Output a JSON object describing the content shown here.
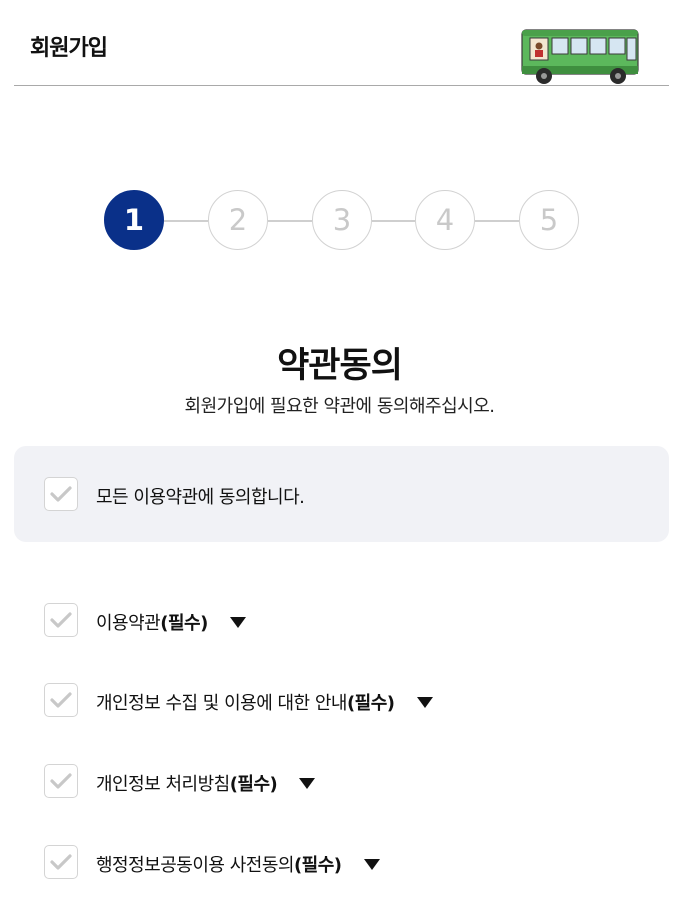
{
  "header": {
    "title": "회원가입"
  },
  "stepper": {
    "steps": [
      "1",
      "2",
      "3",
      "4",
      "5"
    ],
    "active": 1
  },
  "section": {
    "title": "약관동의",
    "subtitle": "회원가입에 필요한 약관에 동의해주십시오."
  },
  "agree_all": {
    "label": "모든 이용약관에 동의합니다.",
    "checked": false
  },
  "terms": [
    {
      "name": "이용약관",
      "required": "(필수)",
      "checked": false
    },
    {
      "name": "개인정보 수집 및 이용에 대한 안내",
      "required": "(필수)",
      "checked": false
    },
    {
      "name": "개인정보 처리방침",
      "required": "(필수)",
      "checked": false
    },
    {
      "name": "행정정보공동이용 사전동의",
      "required": "(필수)",
      "checked": false
    }
  ],
  "colors": {
    "accent": "#0a3089",
    "panel_bg": "#f1f2f6",
    "bus_green": "#5cb85c"
  },
  "icons": {
    "check": "checkmark-icon",
    "expand": "triangle-down-icon",
    "logo": "bus-icon"
  }
}
